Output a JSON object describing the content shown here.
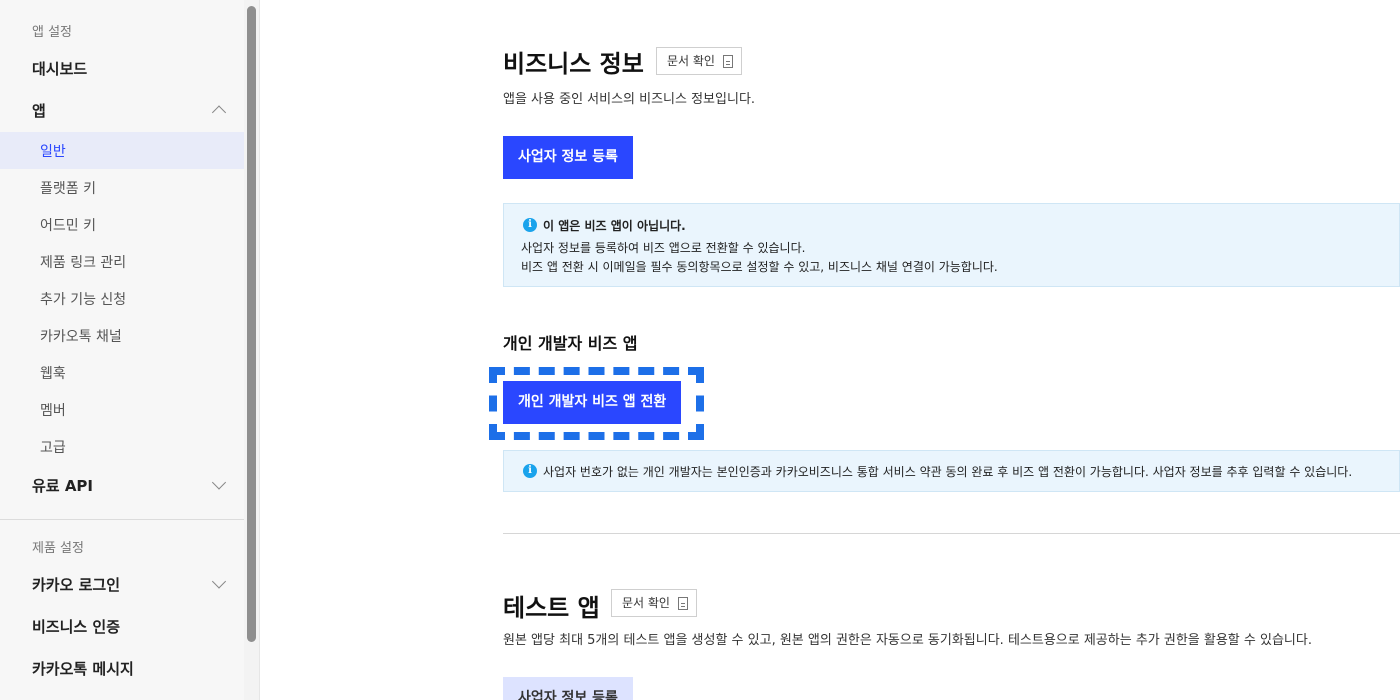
{
  "sidebar": {
    "app_settings_label": "앱 설정",
    "dashboard": "대시보드",
    "app": "앱",
    "app_items": [
      {
        "label": "일반",
        "active": true
      },
      {
        "label": "플랫폼 키"
      },
      {
        "label": "어드민 키"
      },
      {
        "label": "제품 링크 관리"
      },
      {
        "label": "추가 기능 신청"
      },
      {
        "label": "카카오톡 채널"
      },
      {
        "label": "웹훅"
      },
      {
        "label": "멤버"
      },
      {
        "label": "고급"
      }
    ],
    "paid_api": "유료 API",
    "product_settings_label": "제품 설정",
    "kakao_login": "카카오 로그인",
    "business_auth": "비즈니스 인증",
    "kakaotalk_message": "카카오톡 메시지"
  },
  "business_info": {
    "title": "비즈니스 정보",
    "doc_button": "문서 확인",
    "description": "앱을 사용 중인 서비스의 비즈니스 정보입니다.",
    "register_button": "사업자 정보 등록",
    "notice_title": "이 앱은 비즈 앱이 아닙니다.",
    "notice_line1": "사업자 정보를 등록하여 비즈 앱으로 전환할 수 있습니다.",
    "notice_line2": "비즈 앱 전환 시 이메일을 필수 동의항목으로 설정할 수 있고, 비즈니스 채널 연결이 가능합니다."
  },
  "personal_biz": {
    "heading": "개인 개발자 비즈 앱",
    "convert_button": "개인 개발자 비즈 앱 전환",
    "notice": "사업자 번호가 없는 개인 개발자는 본인인증과 카카오비즈니스 통합 서비스 약관 동의 완료 후 비즈 앱 전환이 가능합니다. 사업자 정보를 추후 입력할 수 있습니다."
  },
  "test_app": {
    "title": "테스트 앱",
    "doc_button": "문서 확인",
    "description": "원본 앱당 최대 5개의 테스트 앱을 생성할 수 있고, 원본 앱의 권한은 자동으로 동기화됩니다. 테스트용으로 제공하는 추가 권한을 활용할 수 있습니다.",
    "register_button": "사업자 정보 등록"
  },
  "colors": {
    "primary": "#2a47ff",
    "info": "#1aa3ec",
    "highlight": "#1d6fe8"
  }
}
